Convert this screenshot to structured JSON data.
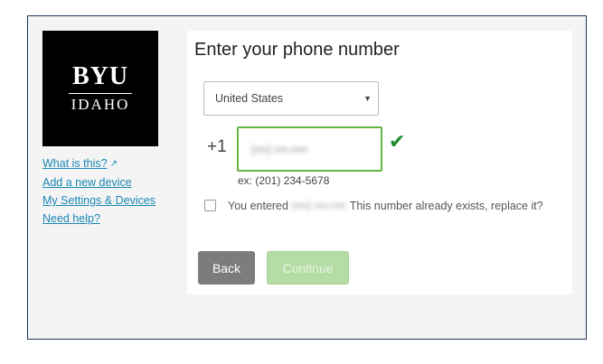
{
  "logo": {
    "top_text": "BYU",
    "bottom_text": "IDAHO"
  },
  "sidebar": {
    "links": [
      {
        "label": "What is this?",
        "icon": "external-link-icon"
      },
      {
        "label": "Add a new device"
      },
      {
        "label": "My Settings & Devices"
      },
      {
        "label": "Need help?"
      }
    ]
  },
  "form": {
    "title": "Enter your phone number",
    "country": {
      "selected": "United States",
      "icon": "caret-down-icon"
    },
    "country_code": "+1",
    "phone": {
      "value": "(•••) •••-••••",
      "valid": true,
      "valid_color": "#1f8a2c",
      "icon": "checkmark-icon"
    },
    "example": "ex: (201) 234-5678",
    "replace": {
      "prefix": "You entered",
      "entered_value": "(•••) •••-••••",
      "suffix": "This number already exists, replace it?",
      "checked": false
    },
    "buttons": {
      "back": "Back",
      "continue": "Continue"
    }
  },
  "colors": {
    "frame_border": "#1f3557",
    "link": "#1a87b5",
    "accent_green": "#67b346"
  }
}
